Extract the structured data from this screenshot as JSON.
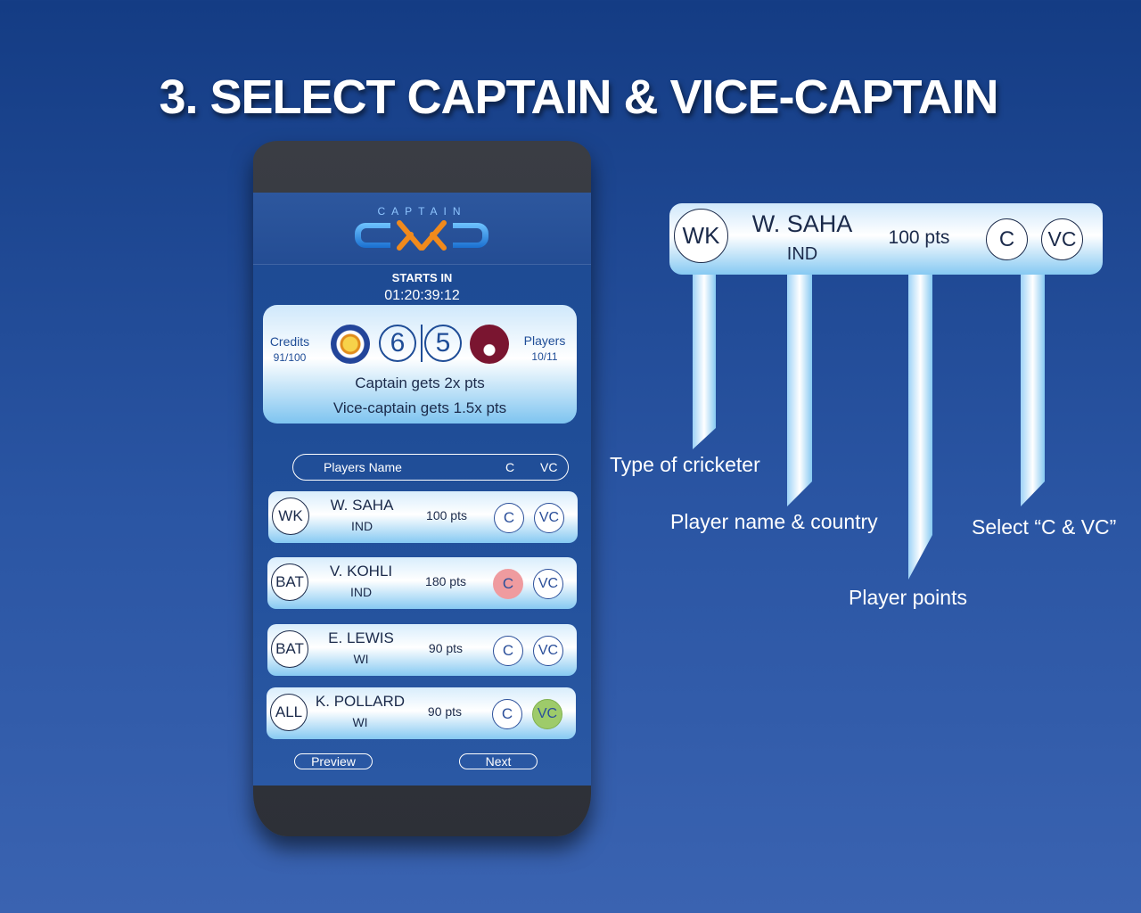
{
  "page": {
    "title": "3. SELECT CAPTAIN & VICE-CAPTAIN"
  },
  "app": {
    "logo_word": "CAPTAIN",
    "starts_label": "STARTS IN",
    "countdown": "01:20:39:12"
  },
  "match": {
    "credits_label": "Credits",
    "credits_value": "91/100",
    "players_label": "Players",
    "players_value": "10/11",
    "team1_count": "6",
    "team2_count": "5",
    "rule_captain": "Captain gets 2x pts",
    "rule_vice": "Vice-captain gets 1.5x pts"
  },
  "list_header": {
    "name": "Players Name",
    "c": "C",
    "vc": "VC"
  },
  "players": [
    {
      "type": "WK",
      "name": "W. SAHA",
      "team": "IND",
      "pts": "100 pts",
      "c": "C",
      "vc": "VC"
    },
    {
      "type": "BAT",
      "name": "V. KOHLI",
      "team": "IND",
      "pts": "180 pts",
      "c": "C",
      "vc": "VC"
    },
    {
      "type": "BAT",
      "name": "E. LEWIS",
      "team": "WI",
      "pts": "90 pts",
      "c": "C",
      "vc": "VC"
    },
    {
      "type": "ALL",
      "name": "K. POLLARD",
      "team": "WI",
      "pts": "90 pts",
      "c": "C",
      "vc": "VC"
    }
  ],
  "selection": {
    "captain": "V. KOHLI",
    "vice_captain": "K. POLLARD"
  },
  "buttons": {
    "preview": "Preview",
    "next": "Next"
  },
  "annotation": {
    "type": "WK",
    "name": "W. SAHA",
    "team": "IND",
    "pts": "100 pts",
    "c": "C",
    "vc": "VC",
    "callouts": {
      "type": "Type of cricketer",
      "name": "Player name & country",
      "points": "Player points",
      "select": "Select “C & VC”"
    }
  },
  "colors": {
    "background": "#1f4d97",
    "captain_selected": "#ef9b9f",
    "vice_selected": "#9ecb6a"
  }
}
